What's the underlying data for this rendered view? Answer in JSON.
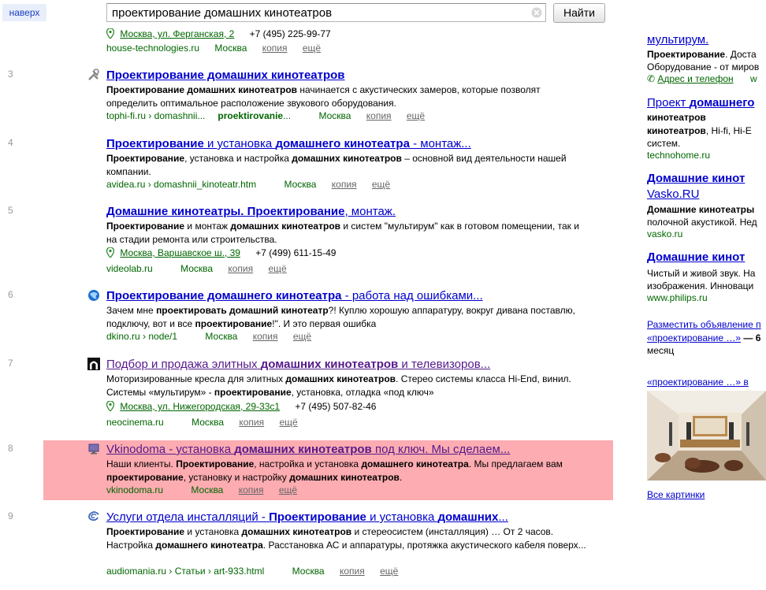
{
  "topbar": {
    "naverh": "наверх",
    "search_value": "проектирование домашних кинотеатров",
    "search_button": "Найти"
  },
  "partial_result": {
    "address": "Москва, ул. Ферганская, 2",
    "phone": "+7 (495) 225-99-77",
    "domain": "house-technologies.ru",
    "city": "Москва",
    "copy": "копия",
    "more": "ещё"
  },
  "results": [
    {
      "num": "3",
      "title_parts": [
        [
          "b",
          "Проектирование домашних кинотеатров"
        ]
      ],
      "snippet_parts": [
        [
          "b",
          "Проектирование домашних кинотеатров"
        ],
        [
          "t",
          " начинается с акустических замеров, которые позволят определить оптимальное расположение звукового оборудования."
        ]
      ],
      "url_parts": [
        [
          "t",
          "tophi-fi.ru › domashnii..."
        ],
        [
          "b",
          "proektirovanie"
        ],
        [
          "t",
          "..."
        ]
      ],
      "city": "Москва",
      "copy": "копия",
      "more": "ещё"
    },
    {
      "num": "4",
      "title_parts": [
        [
          "b",
          "Проектирование"
        ],
        [
          "t",
          " и установка "
        ],
        [
          "b",
          "домашнего кинотеатра"
        ],
        [
          "t",
          " - монтаж..."
        ]
      ],
      "snippet_parts": [
        [
          "b",
          "Проектирование"
        ],
        [
          "t",
          ", установка и настройка "
        ],
        [
          "b",
          "домашних кинотеатров"
        ],
        [
          "t",
          " – основной вид деятельности нашей компании."
        ]
      ],
      "url_parts": [
        [
          "t",
          "avidea.ru › domashnii_kinoteatr.htm"
        ]
      ],
      "city": "Москва",
      "copy": "копия",
      "more": "ещё"
    },
    {
      "num": "5",
      "title_parts": [
        [
          "b",
          "Домашние кинотеатры. Проектирование"
        ],
        [
          "t",
          ", монтаж."
        ]
      ],
      "snippet_parts": [
        [
          "b",
          "Проектирование"
        ],
        [
          "t",
          " и монтаж "
        ],
        [
          "b",
          "домашних кинотеатров"
        ],
        [
          "t",
          " и систем \"мультирум\" как в готовом помещении, так и на стадии ремонта или строительства."
        ]
      ],
      "address": "Москва, Варшавское ш., 39",
      "phone": "+7 (499) 611-15-49",
      "url_parts": [
        [
          "t",
          "videolab.ru"
        ]
      ],
      "city": "Москва",
      "copy": "копия",
      "more": "ещё"
    },
    {
      "num": "6",
      "title_parts": [
        [
          "b",
          "Проектирование домашнего кинотеатра"
        ],
        [
          "t",
          " - работа над ошибками..."
        ]
      ],
      "snippet_parts": [
        [
          "t",
          "Зачем мне "
        ],
        [
          "b",
          "проектировать домашний кинотеатр"
        ],
        [
          "t",
          "?! Куплю хорошую аппаратуру, вокруг дивана поставлю, подключу, вот и все "
        ],
        [
          "b",
          "проектирование"
        ],
        [
          "t",
          "!\". И это первая ошибка"
        ]
      ],
      "url_parts": [
        [
          "t",
          "dkino.ru › node/1"
        ]
      ],
      "city": "Москва",
      "copy": "копия",
      "more": "ещё"
    },
    {
      "num": "7",
      "title_parts": [
        [
          "t",
          "Подбор и продажа элитных "
        ],
        [
          "b",
          "домашних кинотеатров"
        ],
        [
          "t",
          " и телевизоров..."
        ]
      ],
      "snippet_parts": [
        [
          "t",
          "Моторизированные кресла для элитных "
        ],
        [
          "b",
          "домашних кинотеатров"
        ],
        [
          "t",
          ". Стерео системы класса Hi-End, винил. Системы «мультирум» - "
        ],
        [
          "b",
          "проектирование"
        ],
        [
          "t",
          ", установка, отладка «под ключ»"
        ]
      ],
      "address": "Москва, ул. Нижегородская, 29-33с1",
      "phone": "+7 (495) 507-82-46",
      "url_parts": [
        [
          "t",
          "neocinema.ru"
        ]
      ],
      "city": "Москва",
      "copy": "копия",
      "more": "ещё"
    },
    {
      "num": "8",
      "title_parts": [
        [
          "t",
          "Vkinodoma - установка "
        ],
        [
          "b",
          "домашних кинотеатров"
        ],
        [
          "t",
          " под ключ. Мы сделаем..."
        ]
      ],
      "snippet_parts": [
        [
          "t",
          "Наши клиенты. "
        ],
        [
          "b",
          "Проектирование"
        ],
        [
          "t",
          ", настройка и установка "
        ],
        [
          "b",
          "домашнего кинотеатра"
        ],
        [
          "t",
          ". Мы предлагаем вам "
        ],
        [
          "b",
          "проектирование"
        ],
        [
          "t",
          ", установку и настройку "
        ],
        [
          "b",
          "домашних кинотеатров"
        ],
        [
          "t",
          "."
        ]
      ],
      "url_parts": [
        [
          "t",
          "vkinodoma.ru"
        ]
      ],
      "city": "Москва",
      "copy": "копия",
      "more": "ещё"
    },
    {
      "num": "9",
      "title_parts": [
        [
          "t",
          "Услуги отдела инсталляций - "
        ],
        [
          "b",
          "Проектирование"
        ],
        [
          "t",
          " и установка "
        ],
        [
          "b",
          "домашних"
        ],
        [
          "t",
          "..."
        ]
      ],
      "snippet_parts": [
        [
          "b",
          "Проектирование"
        ],
        [
          "t",
          " и установка "
        ],
        [
          "b",
          "домашних кинотеатров"
        ],
        [
          "t",
          " и стереосистем (инсталляция) … От 2 часов. Настройка "
        ],
        [
          "b",
          "домашнего кинотеатра"
        ],
        [
          "t",
          ". Расстановка АС и аппаратуры, протяжка акустического кабеля поверх..."
        ]
      ],
      "url_parts": [
        [
          "t",
          "audiomania.ru › Статьи › art-933.html"
        ]
      ],
      "city": "Москва",
      "copy": "копия",
      "more": "ещё"
    }
  ],
  "right": {
    "ad1_title": "мультирум.",
    "ad1_line1_b": "Проектирование",
    "ad1_line1_t": ". Доста",
    "ad1_line2": "Оборудование - от миров",
    "ad1_addr": "Адрес и телефон",
    "ad1_extra": "w",
    "ad2_title_t": "Проект ",
    "ad2_title_b": "домашнего",
    "ad2_line1_b": "кинотеатров",
    "ad2_line1_t": ", Hi-fi, Hi-E",
    "ad2_line2": "систем.",
    "ad2_url": "technohome.ru",
    "ad3_title1": "Домашние кинот",
    "ad3_title2": "Vasko.RU",
    "ad3_line1": "Домашние кинотеатры",
    "ad3_line2": "полочной акустикой. Нед",
    "ad3_url": "vasko.ru",
    "ad4_title": "Домашние кинот",
    "ad4_line1": "Чистый и живой звук. На",
    "ad4_line2": "изображения. Инноваци",
    "ad4_url": "www.philips.ru",
    "place_ad": "Разместить объявление п",
    "place_query": "«проектирование …»",
    "place_suffix": " — 6",
    "place_month": "месяц",
    "images_query": "«проектирование …» в",
    "all_images": "Все картинки"
  }
}
